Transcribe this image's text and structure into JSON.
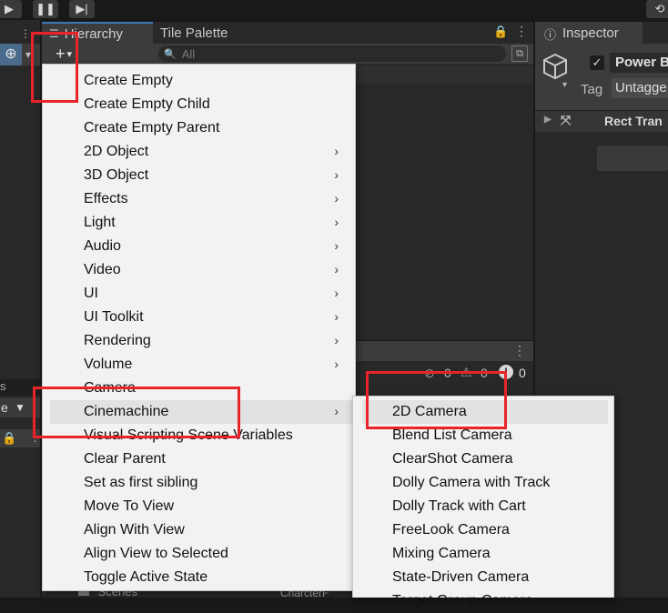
{
  "hierarchy": {
    "tab_label": "Hierarchy",
    "search_placeholder": "All",
    "plus_label": "+",
    "dropdown_arrow": "▾"
  },
  "tile_palette": {
    "tab_label": "Tile Palette"
  },
  "inspector": {
    "tab_label": "Inspector",
    "object_name": "Power B",
    "tag_label": "Tag",
    "tag_value": "Untagge",
    "component_label": "Rect Tran"
  },
  "left_panel": {
    "dropdown_text": "e"
  },
  "console": {
    "error_count": "0",
    "warning_count": "0",
    "info_count": "0"
  },
  "bottom_strip": {
    "scenes_label": "Scenes",
    "character_label": "CharcterF"
  },
  "main_menu": {
    "items": [
      {
        "label": "Create Empty",
        "submenu": false
      },
      {
        "label": "Create Empty Child",
        "submenu": false
      },
      {
        "label": "Create Empty Parent",
        "submenu": false
      },
      {
        "label": "2D Object",
        "submenu": true
      },
      {
        "label": "3D Object",
        "submenu": true
      },
      {
        "label": "Effects",
        "submenu": true
      },
      {
        "label": "Light",
        "submenu": true
      },
      {
        "label": "Audio",
        "submenu": true
      },
      {
        "label": "Video",
        "submenu": true
      },
      {
        "label": "UI",
        "submenu": true
      },
      {
        "label": "UI Toolkit",
        "submenu": true
      },
      {
        "label": "Rendering",
        "submenu": true
      },
      {
        "label": "Volume",
        "submenu": true
      },
      {
        "label": "Camera",
        "submenu": false
      },
      {
        "label": "Cinemachine",
        "submenu": true,
        "highlighted": true
      },
      {
        "label": "Visual Scripting Scene Variables",
        "submenu": false
      },
      {
        "label": "Clear Parent",
        "submenu": false
      },
      {
        "label": "Set as first sibling",
        "submenu": false
      },
      {
        "label": "Move To View",
        "submenu": false
      },
      {
        "label": "Align With View",
        "submenu": false
      },
      {
        "label": "Align View to Selected",
        "submenu": false
      },
      {
        "label": "Toggle Active State",
        "submenu": false
      }
    ],
    "submenu_arrow": "›"
  },
  "cinemachine_menu": {
    "items": [
      {
        "label": "2D Camera",
        "highlighted": true
      },
      {
        "label": "Blend List Camera"
      },
      {
        "label": "ClearShot Camera"
      },
      {
        "label": "Dolly Camera with Track"
      },
      {
        "label": "Dolly Track with Cart"
      },
      {
        "label": "FreeLook Camera"
      },
      {
        "label": "Mixing Camera"
      },
      {
        "label": "State-Driven Camera"
      },
      {
        "label": "Target Group Camera"
      }
    ]
  },
  "colors": {
    "annotation_red": "#e8242a",
    "menu_background": "#f2f2f2",
    "highlight": "#e2e2e2",
    "panel_dark": "#282828",
    "tab_accent": "#3a79bb"
  },
  "icons": [
    "play-icon",
    "pause-icon",
    "step-icon",
    "history-icon",
    "lock-icon",
    "kebab-menu-icon",
    "search-icon",
    "cube-icon",
    "checkbox-icon",
    "foldout-arrow-icon",
    "rect-transform-icon",
    "error-icon",
    "warning-icon",
    "info-icon"
  ]
}
